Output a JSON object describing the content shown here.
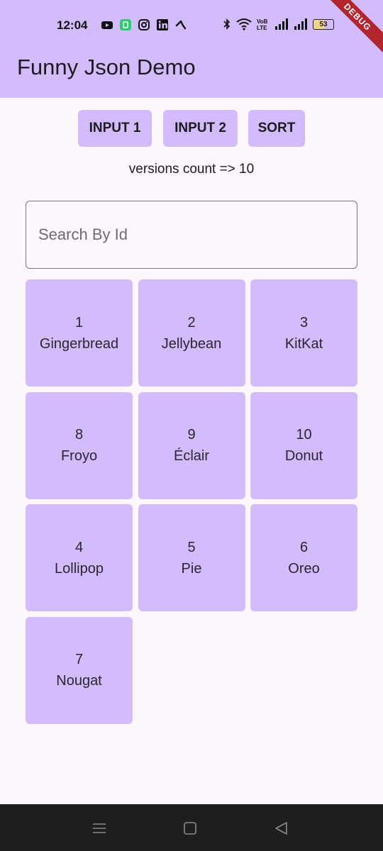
{
  "status": {
    "time": "12:04",
    "battery": "53"
  },
  "debug_banner": "DEBUG",
  "app": {
    "title": "Funny Json Demo"
  },
  "buttons": {
    "input1": "INPUT 1",
    "input2": "INPUT 2",
    "sort": "SORT"
  },
  "versions_count_text": "versions count => 10",
  "search": {
    "placeholder": "Search By Id",
    "value": ""
  },
  "tiles": [
    {
      "id": "1",
      "name": "Gingerbread"
    },
    {
      "id": "2",
      "name": "Jellybean"
    },
    {
      "id": "3",
      "name": "KitKat"
    },
    {
      "id": "8",
      "name": "Froyo"
    },
    {
      "id": "9",
      "name": "Éclair"
    },
    {
      "id": "10",
      "name": "Donut"
    },
    {
      "id": "4",
      "name": "Lollipop"
    },
    {
      "id": "5",
      "name": "Pie"
    },
    {
      "id": "6",
      "name": "Oreo"
    },
    {
      "id": "7",
      "name": "Nougat"
    }
  ],
  "colors": {
    "primary_container": "#d2bcfe",
    "background": "#fef7ff",
    "debug": "#b3262e",
    "nav_bar": "#1e1e1e"
  },
  "icons": {
    "status_left": [
      "youtube-icon",
      "app-notification-icon",
      "instagram-icon",
      "linkedin-icon",
      "call-icon"
    ],
    "status_right": [
      "bluetooth-icon",
      "wifi-icon",
      "volte-icon",
      "signal-icon",
      "signal-icon",
      "battery-icon"
    ],
    "nav": [
      "menu-icon",
      "home-icon",
      "back-icon"
    ]
  }
}
